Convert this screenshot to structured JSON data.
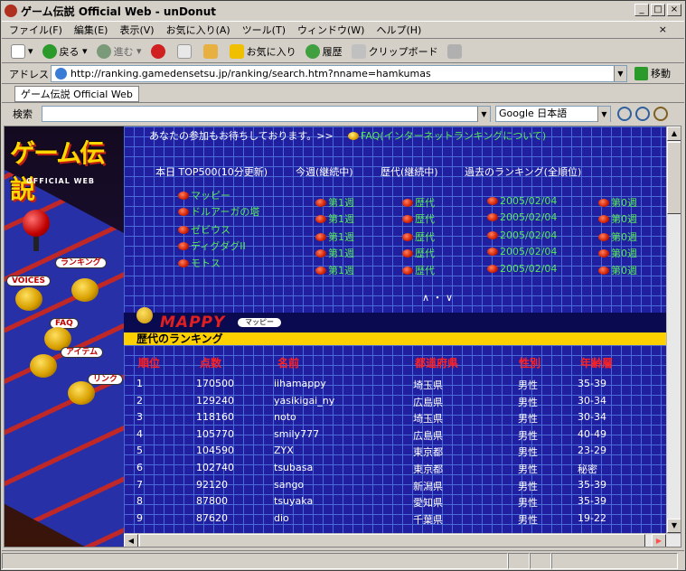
{
  "window": {
    "title": "ゲーム伝説 Official Web - unDonut"
  },
  "menu": [
    "ファイル(F)",
    "編集(E)",
    "表示(V)",
    "お気に入り(A)",
    "ツール(T)",
    "ウィンドウ(W)",
    "ヘルプ(H)"
  ],
  "toolbar": {
    "back": "戻る",
    "forward": "進む",
    "favorites": "お気に入り",
    "history": "履歴",
    "clipboard": "クリップボード"
  },
  "address": {
    "label": "アドレス",
    "url": "http://ranking.gamedensetsu.jp/ranking/search.htm?nname=hamkumas",
    "go": "移動"
  },
  "tab": {
    "label": "ゲーム伝説 Official Web"
  },
  "search": {
    "label": "検索",
    "engine": "Google 日本語"
  },
  "sidebar": {
    "logo": "ゲーム伝説",
    "logo_sub": "OFFICIAL WEB",
    "links": [
      "ランキング",
      "VOICES",
      "FAQ",
      "アイテム",
      "リンク"
    ]
  },
  "page": {
    "intro": "あなたの参加もお待ちしております。>>",
    "faq_link": "FAQ(インターネットランキングについて)",
    "headers": [
      "本日 TOP500(10分更新)",
      "今週(継続中)",
      "歴代(継続中)",
      "過去のランキング(全順位)"
    ],
    "games": [
      "マッピー",
      "ドルアーガの塔",
      "ゼビウス",
      "ディグダグII",
      "モトス"
    ],
    "weekly": [
      "第1週",
      "第1週",
      "第1週",
      "第1週",
      "第1週"
    ],
    "alltime": [
      "歴代",
      "歴代",
      "歴代",
      "歴代",
      "歴代"
    ],
    "past": [
      "2005/02/04",
      "2005/02/04",
      "2005/02/04",
      "2005/02/04",
      "2005/02/04"
    ],
    "week0": [
      "第0週",
      "第0週",
      "第0週",
      "第0週",
      "第0週"
    ],
    "nav_arrows": "∧ ・ ∨",
    "game_title": "MAPPY",
    "game_tag": "マッピー",
    "ranking_title": "歴代のランキング",
    "columns": [
      "順位",
      "点数",
      "名前",
      "都道府県",
      "性別",
      "年齢層"
    ],
    "rows": [
      [
        "1",
        "170500",
        "iihamappy",
        "埼玉県",
        "男性",
        "35-39"
      ],
      [
        "2",
        "129240",
        "yasikigai_ny",
        "広島県",
        "男性",
        "30-34"
      ],
      [
        "3",
        "118160",
        "noto",
        "埼玉県",
        "男性",
        "30-34"
      ],
      [
        "4",
        "105770",
        "smily777",
        "広島県",
        "男性",
        "40-49"
      ],
      [
        "5",
        "104590",
        "ZYX",
        "東京都",
        "男性",
        "23-29"
      ],
      [
        "6",
        "102740",
        "tsubasa",
        "東京都",
        "男性",
        "秘密"
      ],
      [
        "7",
        "92120",
        "sango",
        "新潟県",
        "男性",
        "35-39"
      ],
      [
        "8",
        "87800",
        "tsuyaka",
        "愛知県",
        "男性",
        "35-39"
      ],
      [
        "9",
        "87620",
        "dio",
        "千葉県",
        "男性",
        "19-22"
      ]
    ]
  }
}
